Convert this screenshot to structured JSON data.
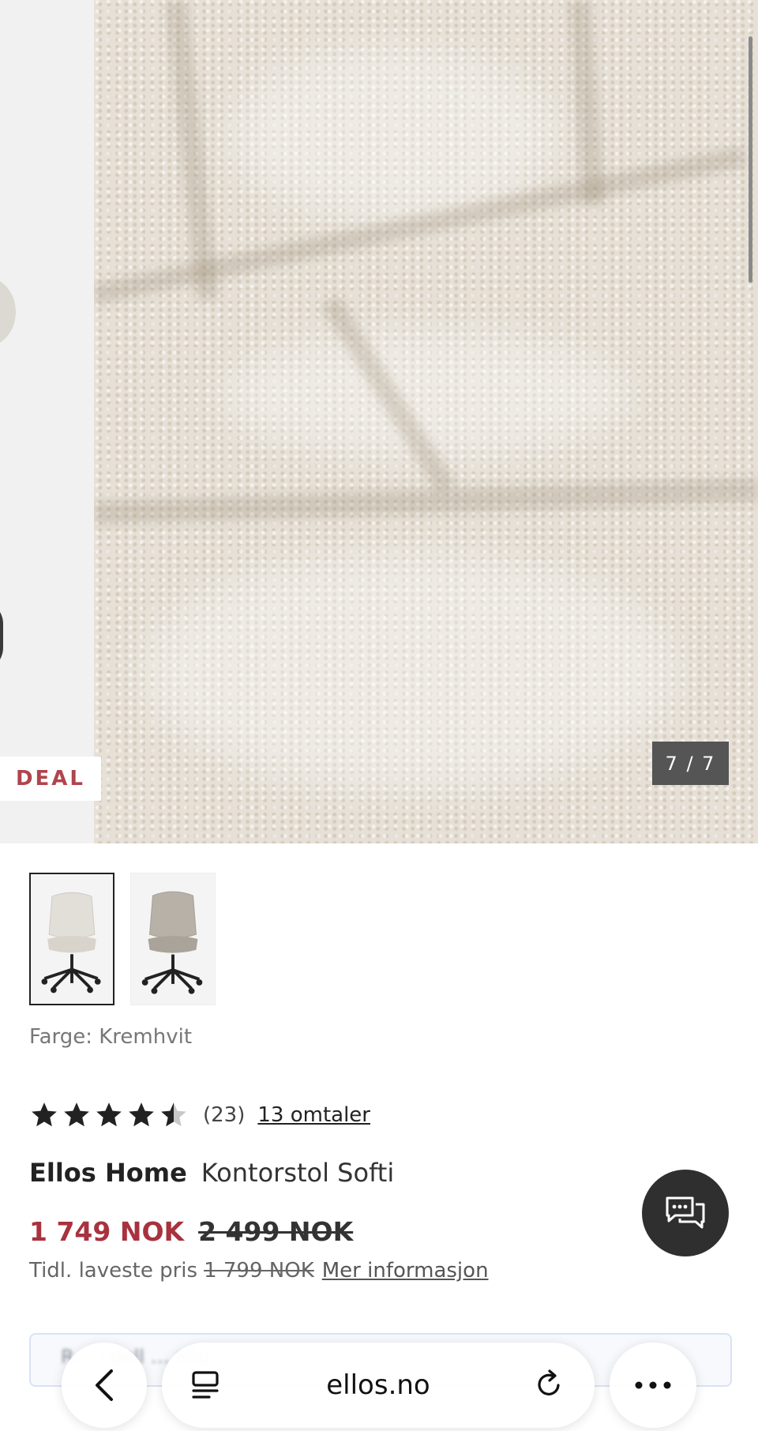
{
  "gallery": {
    "deal_badge": "DEAL",
    "counter": "7 / 7"
  },
  "product": {
    "color_label": "Farge: Kremhvit",
    "rating_value": 4.5,
    "rating_count": "(23)",
    "reviews_link": "13 omtaler",
    "brand": "Ellos Home",
    "name": "Kontorstol Softi",
    "price_now": "1 749 NOK",
    "price_old": "2 499 NOK",
    "lowest_label": "Tidl. laveste pris",
    "lowest_price": "1 799 NOK",
    "more_info": "Mer informasjon"
  },
  "partial_banner": {
    "text": "R… i dell … ello"
  },
  "browser": {
    "url": "ellos.no"
  },
  "colors": {
    "sale_red": "#a8323e",
    "chat_bg": "#2f2f2f",
    "deal_red": "#b0444d"
  }
}
